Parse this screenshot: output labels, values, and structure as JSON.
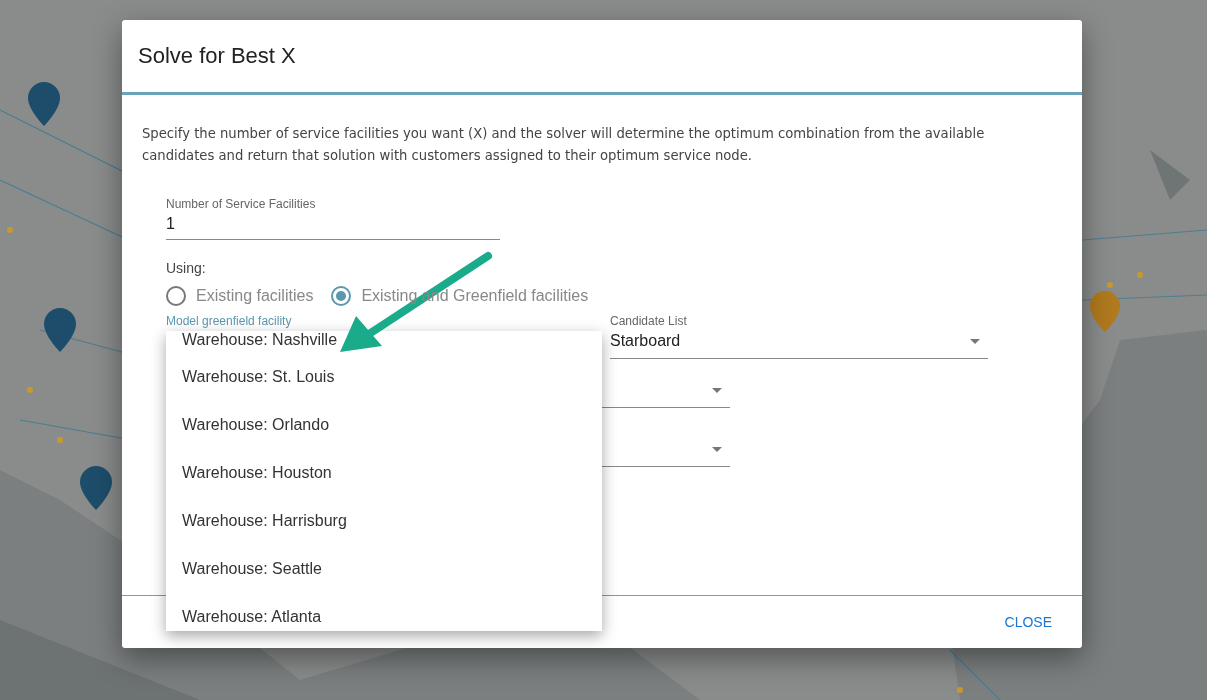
{
  "dialog": {
    "title": "Solve for Best X",
    "description": "Specify the number of service facilities you want (X) and the solver will determine the optimum combination from the available candidates and return that solution with customers assigned to their optimum service node.",
    "count_field": {
      "label": "Number of Service Facilities",
      "value": "1"
    },
    "using_label": "Using:",
    "options": [
      {
        "label": "Existing facilities",
        "selected": false
      },
      {
        "label": "Existing and Greenfield facilities",
        "selected": true
      }
    ],
    "model_field": {
      "label": "Model greenfield facility"
    },
    "candidate_field": {
      "label": "Candidate List",
      "value": "Starboard"
    },
    "extra_selects": [
      {
        "kind": "select"
      },
      {
        "kind": "select"
      }
    ],
    "menu": {
      "items": [
        {
          "label": "Warehouse: Nashville"
        },
        {
          "label": "Warehouse: St. Louis"
        },
        {
          "label": "Warehouse: Orlando"
        },
        {
          "label": "Warehouse: Houston"
        },
        {
          "label": "Warehouse: Harrisburg"
        },
        {
          "label": "Warehouse: Seattle"
        },
        {
          "label": "Warehouse: Atlanta"
        }
      ]
    },
    "buttons": [
      {
        "label": "CLOSE"
      }
    ]
  },
  "annotation": {
    "kind": "arrow"
  }
}
